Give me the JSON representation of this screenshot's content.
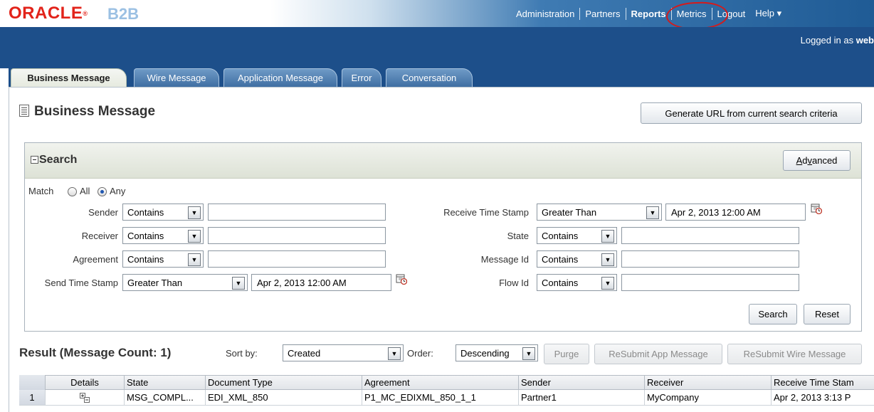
{
  "brand": {
    "oracle": "ORACLE",
    "product": "B2B"
  },
  "global_nav": [
    "Administration",
    "Partners",
    "Reports",
    "Metrics",
    "Logout",
    "Help ▾"
  ],
  "logged_in": {
    "prefix": "Logged in as ",
    "user": "web"
  },
  "tabs": [
    "Business Message",
    "Wire Message",
    "Application Message",
    "Error",
    "Conversation"
  ],
  "page": {
    "title": "Business Message",
    "generate_url_label": "Generate URL from current search criteria"
  },
  "search": {
    "title": "Search",
    "advanced_label": "Advanced",
    "match_label": "Match",
    "match_all": "All",
    "match_any": "Any",
    "match_selected": "Any",
    "fields_left": [
      {
        "label": "Sender",
        "operator": "Contains",
        "value": ""
      },
      {
        "label": "Receiver",
        "operator": "Contains",
        "value": ""
      },
      {
        "label": "Agreement",
        "operator": "Contains",
        "value": ""
      },
      {
        "label": "Send Time Stamp",
        "operator": "Greater Than",
        "value": "Apr 2, 2013 12:00 AM"
      }
    ],
    "fields_right": [
      {
        "label": "Receive Time Stamp",
        "operator": "Greater Than",
        "value": "Apr 2, 2013 12:00 AM"
      },
      {
        "label": "State",
        "operator": "Contains",
        "value": ""
      },
      {
        "label": "Message Id",
        "operator": "Contains",
        "value": ""
      },
      {
        "label": "Flow Id",
        "operator": "Contains",
        "value": ""
      }
    ],
    "search_label": "Search",
    "reset_label": "Reset"
  },
  "results": {
    "title": "Result (Message Count: 1)",
    "sort_by_label": "Sort by:",
    "sort_by_value": "Created",
    "order_label": "Order:",
    "order_value": "Descending",
    "purge_label": "Purge",
    "resubmit_app_label": "ReSubmit App Message",
    "resubmit_wire_label": "ReSubmit Wire Message",
    "columns": [
      "Details",
      "State",
      "Document Type",
      "Agreement",
      "Sender",
      "Receiver",
      "Receive Time Stam"
    ],
    "rows": [
      {
        "num": "1",
        "state": "MSG_COMPL...",
        "document_type": "EDI_XML_850",
        "agreement": "P1_MC_EDIXML_850_1_1",
        "sender": "Partner1",
        "receiver": "MyCompany",
        "receive_time": "Apr 2, 2013 3:13 P"
      }
    ]
  },
  "colors": {
    "brand_red": "#e2231a",
    "nav_blue": "#1d4f8a",
    "annotation_red": "#d61a1a"
  }
}
